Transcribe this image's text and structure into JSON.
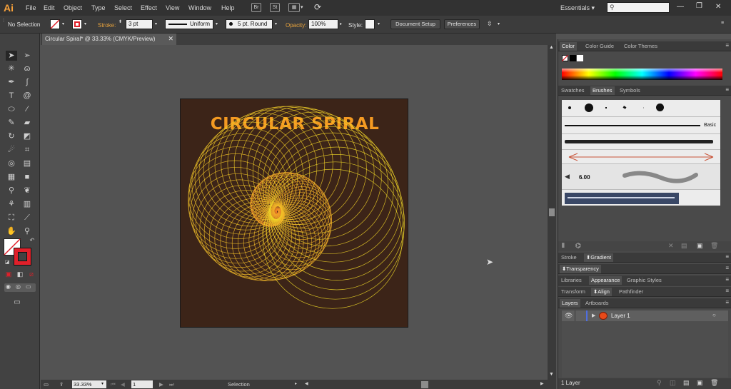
{
  "app": {
    "logo": "Ai",
    "workspace": "Essentials"
  },
  "menu": [
    "File",
    "Edit",
    "Object",
    "Type",
    "Select",
    "Effect",
    "View",
    "Window",
    "Help"
  ],
  "topbar_icons": {
    "bridge": "Br",
    "stock": "St"
  },
  "control_bar": {
    "selection": "No Selection",
    "stroke_label": "Stroke:",
    "stroke_value": "3 pt",
    "profile": "Uniform",
    "brush": "5 pt. Round",
    "opacity_label": "Opacity:",
    "opacity_value": "100%",
    "style_label": "Style:",
    "document_setup": "Document Setup",
    "preferences": "Preferences"
  },
  "document": {
    "tab_title": "Circular Spiral* @ 33.33% (CMYK/Preview)",
    "artboard_title": "CIRCULAR SPIRAL"
  },
  "status_bar": {
    "zoom": "33.33%",
    "page": "1",
    "tool": "Selection"
  },
  "panels": {
    "color_tabs": [
      "Color",
      "Color Guide",
      "Color Themes"
    ],
    "brush_tabs": [
      "Swatches",
      "Brushes",
      "Symbols"
    ],
    "brush_basic": "Basic",
    "brush_size": "6.00",
    "stroke_gradient_tabs": [
      "Stroke",
      "Gradient"
    ],
    "transparency": "Transparency",
    "libraries_tabs": [
      "Libraries",
      "Appearance",
      "Graphic Styles"
    ],
    "transform_tabs": [
      "Transform",
      "Align",
      "Pathfinder"
    ],
    "layers_tabs": [
      "Layers",
      "Artboards"
    ],
    "layer_name": "Layer 1",
    "layers_count": "1 Layer"
  },
  "colors": {
    "accent": "#f49a22",
    "artboard_bg": "#3c2418",
    "spiral_stroke": "#f0641e",
    "stroke_swatch": "#e0202a"
  }
}
